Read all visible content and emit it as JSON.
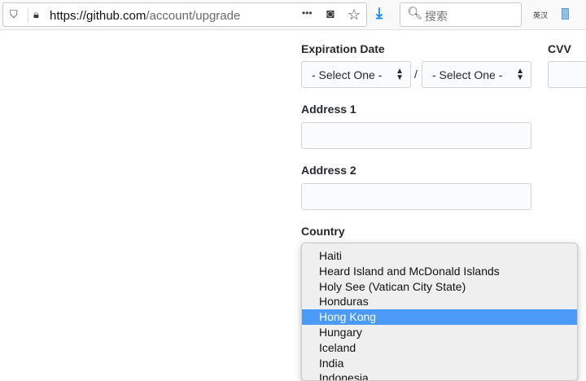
{
  "browser": {
    "url_host": "https://github.com",
    "url_path": "/account/upgrade",
    "search_placeholder": "搜索",
    "ext_label": "英汉",
    "more": "•••"
  },
  "form": {
    "expiration_label": "Expiration Date",
    "month_select": "- Select One -",
    "year_select": "- Select One -",
    "slash": "/",
    "cvv_label": "CVV",
    "address1_label": "Address 1",
    "address2_label": "Address 2",
    "country_label": "Country"
  },
  "country_options": [
    "Haiti",
    "Heard Island and McDonald Islands",
    "Holy See (Vatican City State)",
    "Honduras",
    "Hong Kong",
    "Hungary",
    "Iceland",
    "India",
    "Indonesia"
  ],
  "selected_country": "Hong Kong",
  "colors": {
    "highlight": "#4a9af8",
    "download": "#0a84ff"
  }
}
